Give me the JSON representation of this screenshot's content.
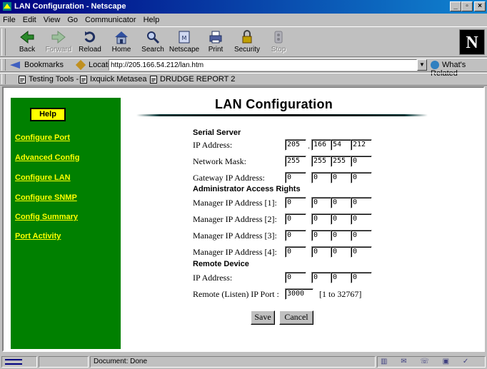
{
  "window": {
    "title": "LAN Configuration - Netscape",
    "controls": [
      "_",
      "▫",
      "×"
    ]
  },
  "menu": [
    "File",
    "Edit",
    "View",
    "Go",
    "Communicator",
    "Help"
  ],
  "toolbar": {
    "back": "Back",
    "forward": "Forward",
    "reload": "Reload",
    "home": "Home",
    "search": "Search",
    "netscape": "Netscape",
    "print": "Print",
    "security": "Security",
    "stop": "Stop",
    "logo": "N"
  },
  "location": {
    "bookmarks": "Bookmarks",
    "label": "Location:",
    "url": "http://205.166.54.212/lan.htm",
    "whats_related": "What's Related"
  },
  "personal_toolbar": {
    "items": [
      "Testing Tools -",
      "Ixquick Metasea",
      "DRUDGE REPORT 2"
    ]
  },
  "sidebar": {
    "help": "Help",
    "links": [
      "Configure Port",
      "Advanced Config",
      "Configure LAN",
      "Configure SNMP",
      "Config Summary",
      "Port Activity"
    ]
  },
  "page": {
    "title": "LAN Configuration",
    "serial_server": {
      "heading": "Serial Server",
      "ip_label": "IP Address:",
      "ip": [
        "205",
        "166",
        "54",
        "212"
      ],
      "mask_label": "Network Mask:",
      "mask": [
        "255",
        "255",
        "255",
        "0"
      ],
      "gateway_label": "Gateway IP Address:",
      "gateway": [
        "0",
        "0",
        "0",
        "0"
      ]
    },
    "admin": {
      "heading": "Administrator Access Rights",
      "managers": [
        {
          "label": "Manager IP Address [1]:",
          "ip": [
            "0",
            "0",
            "0",
            "0"
          ]
        },
        {
          "label": "Manager IP Address [2]:",
          "ip": [
            "0",
            "0",
            "0",
            "0"
          ]
        },
        {
          "label": "Manager IP Address [3]:",
          "ip": [
            "0",
            "0",
            "0",
            "0"
          ]
        },
        {
          "label": "Manager IP Address [4]:",
          "ip": [
            "0",
            "0",
            "0",
            "0"
          ]
        }
      ]
    },
    "remote": {
      "heading": "Remote Device",
      "ip_label": "IP Address:",
      "ip": [
        "0",
        "0",
        "0",
        "0"
      ],
      "port_label": "Remote (Listen) IP Port :",
      "port": "3000",
      "port_range": "[1 to 32767]"
    },
    "save": "Save",
    "cancel": "Cancel"
  },
  "status": {
    "text": "Document: Done"
  },
  "colors": {
    "sidebar": "#008000",
    "link": "#ffff00",
    "help_bg": "#ffff00",
    "titlebar": "#000080"
  }
}
